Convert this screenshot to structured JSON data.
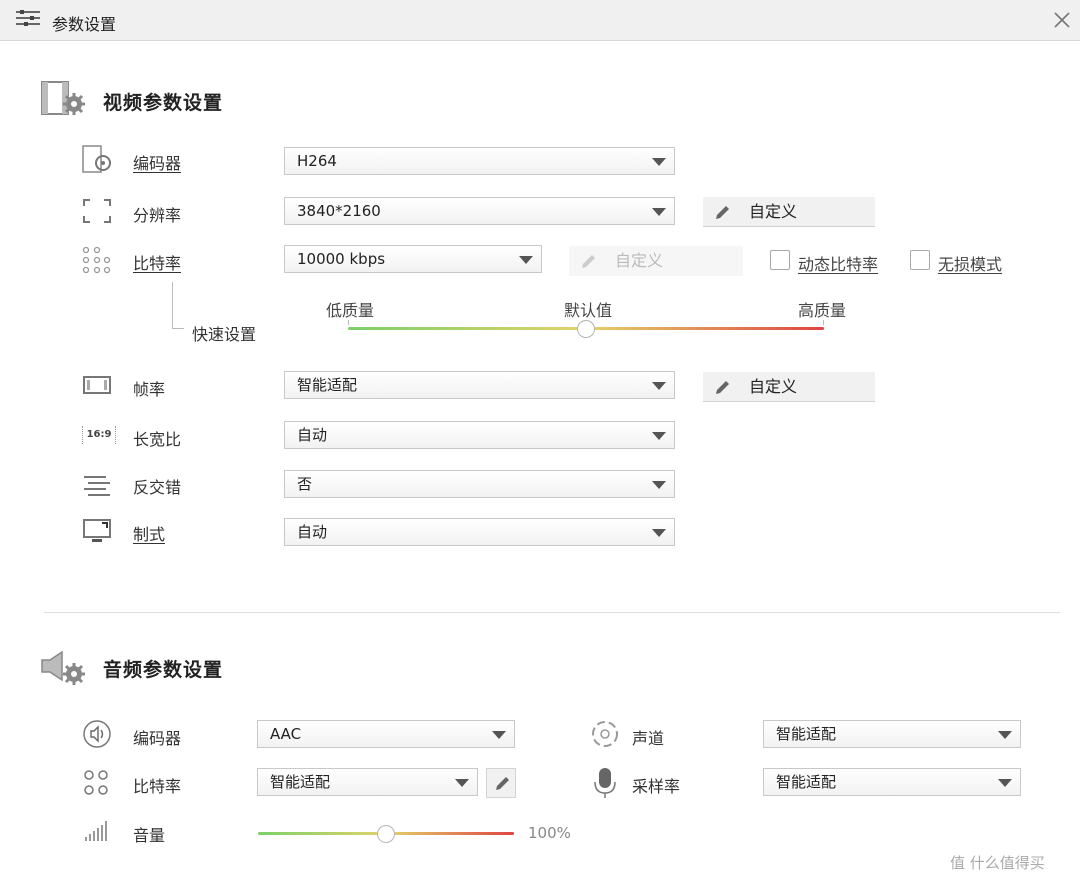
{
  "window": {
    "title": "参数设置"
  },
  "video": {
    "title": "视频参数设置",
    "encoder": {
      "label": "编码器",
      "value": "H264"
    },
    "resolution": {
      "label": "分辨率",
      "value": "3840*2160",
      "custom_label": "自定义"
    },
    "bitrate": {
      "label": "比特率",
      "value": "10000 kbps",
      "custom_label": "自定义",
      "dynamic_label": "动态比特率",
      "lossless_label": "无损模式"
    },
    "quick": {
      "label": "快速设置",
      "low": "低质量",
      "default": "默认值",
      "high": "高质量",
      "position": 0.5
    },
    "framerate": {
      "label": "帧率",
      "value": "智能适配",
      "custom_label": "自定义"
    },
    "aspect": {
      "label": "长宽比",
      "value": "自动",
      "icon_text": "16:9"
    },
    "deinterlace": {
      "label": "反交错",
      "value": "否"
    },
    "standard": {
      "label": "制式",
      "value": "自动"
    }
  },
  "audio": {
    "title": "音频参数设置",
    "encoder": {
      "label": "编码器",
      "value": "AAC"
    },
    "channel": {
      "label": "声道",
      "value": "智能适配"
    },
    "bitrate": {
      "label": "比特率",
      "value": "智能适配"
    },
    "samplerate": {
      "label": "采样率",
      "value": "智能适配"
    },
    "volume": {
      "label": "音量",
      "value_text": "100%",
      "level": 1.0
    }
  },
  "watermark": {
    "text": "值 什么值得买"
  }
}
